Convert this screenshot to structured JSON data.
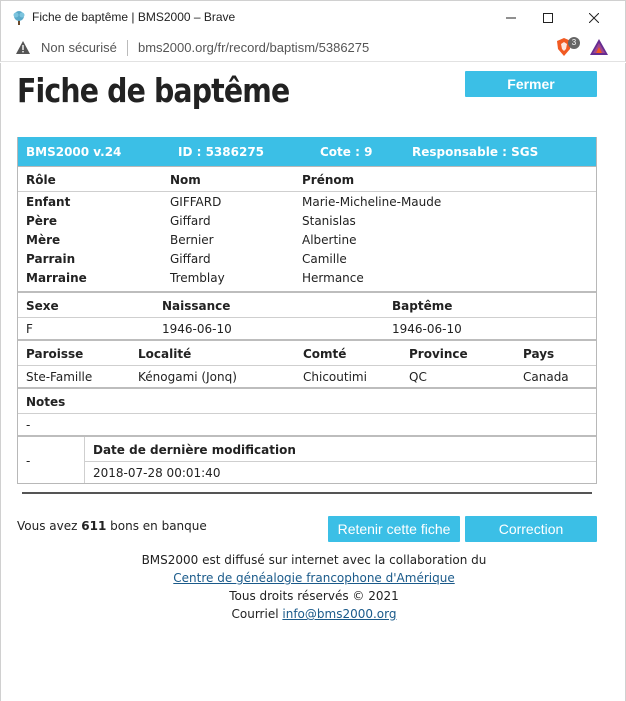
{
  "window": {
    "title": "Fiche de baptême | BMS2000 – Brave",
    "insecure_label": "Non sécurisé",
    "url": "bms2000.org/fr/record/baptism/5386275",
    "shield_count": "3"
  },
  "page": {
    "title": "Fiche de baptême",
    "close_label": "Fermer"
  },
  "record": {
    "header": {
      "version": "BMS2000 v.24",
      "id": "ID : 5386275",
      "cote": "Cote : 9",
      "responsable": "Responsable : SGS"
    },
    "persons": {
      "headers": [
        "Rôle",
        "Nom",
        "Prénom"
      ],
      "rows": [
        {
          "role": "Enfant",
          "nom": "GIFFARD",
          "prenom": "Marie-Micheline-Maude"
        },
        {
          "role": "Père",
          "nom": "Giffard",
          "prenom": "Stanislas"
        },
        {
          "role": "Mère",
          "nom": "Bernier",
          "prenom": "Albertine"
        },
        {
          "role": "Parrain",
          "nom": "Giffard",
          "prenom": "Camille"
        },
        {
          "role": "Marraine",
          "nom": "Tremblay",
          "prenom": "Hermance"
        }
      ]
    },
    "vitals": {
      "headers": [
        "Sexe",
        "Naissance",
        "Baptême"
      ],
      "values": [
        "F",
        "1946-06-10",
        "1946-06-10"
      ]
    },
    "place": {
      "headers": [
        "Paroisse",
        "Localité",
        "Comté",
        "Province",
        "Pays"
      ],
      "values": [
        "Ste-Famille",
        "Kénogami (Jonq)",
        "Chicoutimi",
        "QC",
        "Canada"
      ]
    },
    "notes": {
      "header": "Notes",
      "value": "-"
    },
    "modification": {
      "left_value": "-",
      "header": "Date de dernière modification",
      "value": "2018-07-28 00:01:40"
    }
  },
  "actions": {
    "bank_prefix": "Vous avez",
    "bank_count": "611",
    "bank_suffix": "bons en banque",
    "keep_label": "Retenir cette fiche",
    "correction_label": "Correction"
  },
  "footer": {
    "line1": "BMS2000 est diffusé sur internet avec la collaboration du",
    "link1": "Centre de généalogie francophone d'Amérique",
    "line3": "Tous droits réservés © 2021",
    "contact_prefix": "Courriel",
    "contact_email": "info@bms2000.org"
  },
  "colors": {
    "accent": "#3bbfe6",
    "link": "#1a5a8a"
  }
}
